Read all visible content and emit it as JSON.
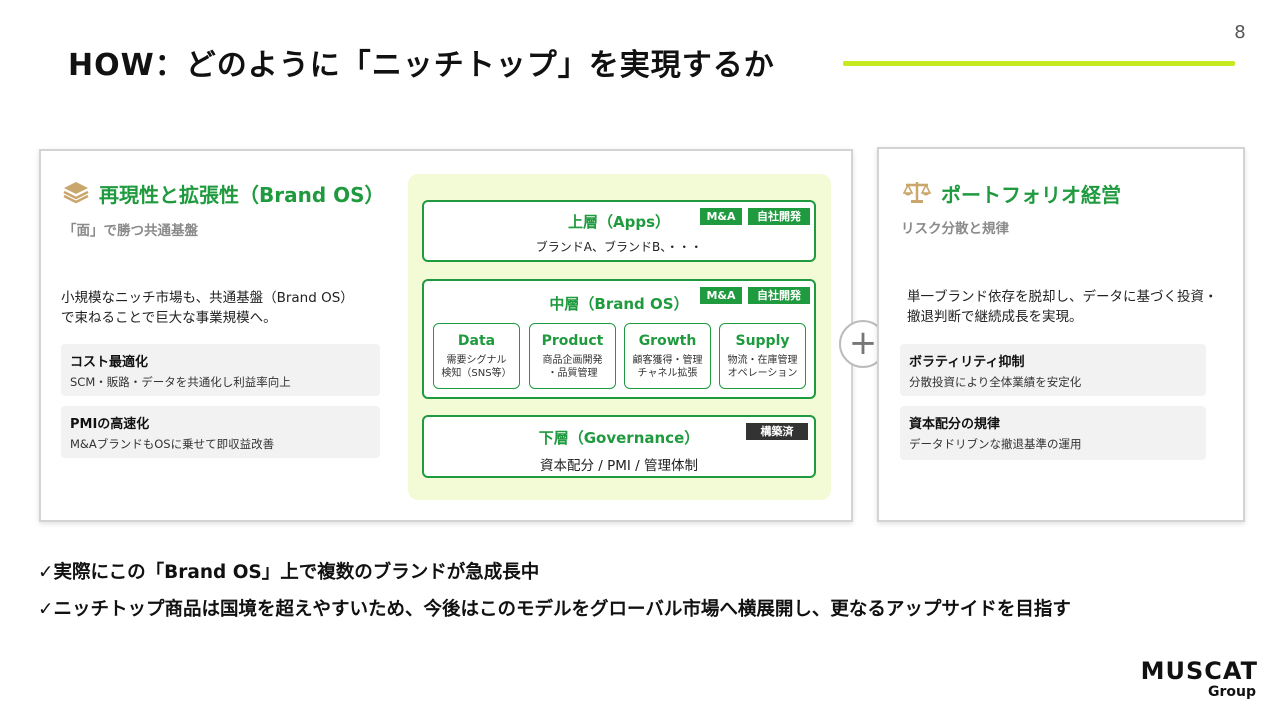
{
  "page_number": "8",
  "title": "HOW：どのように「ニッチトップ」を実現するか",
  "colors": {
    "accent_green": "#1f9a3e",
    "title_line": "#c5ea1f",
    "diagram_bg": "#f3fbd6",
    "icon_gold": "#c9a66b"
  },
  "left": {
    "icon": "layers-icon",
    "title": "再現性と拡張性（Brand OS）",
    "subtitle": "「面」で勝つ共通基盤",
    "body": "小規模なニッチ市場も、共通基盤（Brand OS）で束ねることで巨大な事業規模へ。",
    "points": [
      {
        "title": "コスト最適化",
        "text": "SCM・販路・データを共通化し利益率向上"
      },
      {
        "title": "PMIの高速化",
        "text": "M&AブランドもOSに乗せて即収益改善"
      }
    ]
  },
  "diagram": {
    "upper": {
      "title": "上層（Apps）",
      "desc": "ブランドA、ブランドB、・・・",
      "badges": [
        "M&A",
        "自社開発"
      ]
    },
    "middle": {
      "title": "中層（Brand OS）",
      "badges": [
        "M&A",
        "自社開発"
      ],
      "modules": [
        {
          "name": "Data",
          "desc1": "需要シグナル",
          "desc2": "検知（SNS等）"
        },
        {
          "name": "Product",
          "desc1": "商品企画開発",
          "desc2": "・品質管理"
        },
        {
          "name": "Growth",
          "desc1": "顧客獲得・管理",
          "desc2": "チャネル拡張"
        },
        {
          "name": "Supply",
          "desc1": "物流・在庫管理",
          "desc2": "オペレーション"
        }
      ]
    },
    "lower": {
      "title": "下層（Governance）",
      "desc": "資本配分 / PMI / 管理体制",
      "badge": "構築済"
    }
  },
  "plus_icon": "plus-icon",
  "right": {
    "icon": "balance-scale-icon",
    "title": "ポートフォリオ経営",
    "subtitle": "リスク分散と規律",
    "body": "単一ブランド依存を脱却し、データに基づく投資・撤退判断で継続成長を実現。",
    "points": [
      {
        "title": "ボラティリティ抑制",
        "text": "分散投資により全体業績を安定化"
      },
      {
        "title": "資本配分の規律",
        "text": "データドリブンな撤退基準の運用"
      }
    ]
  },
  "conclusions": [
    "✓実際にこの「Brand OS」上で複数のブランドが急成長中",
    "✓ニッチトップ商品は国境を超えやすいため、今後はこのモデルをグローバル市場へ横展開し、更なるアップサイドを目指す"
  ],
  "logo": {
    "main": "MUSCAT",
    "sub": "Group"
  }
}
